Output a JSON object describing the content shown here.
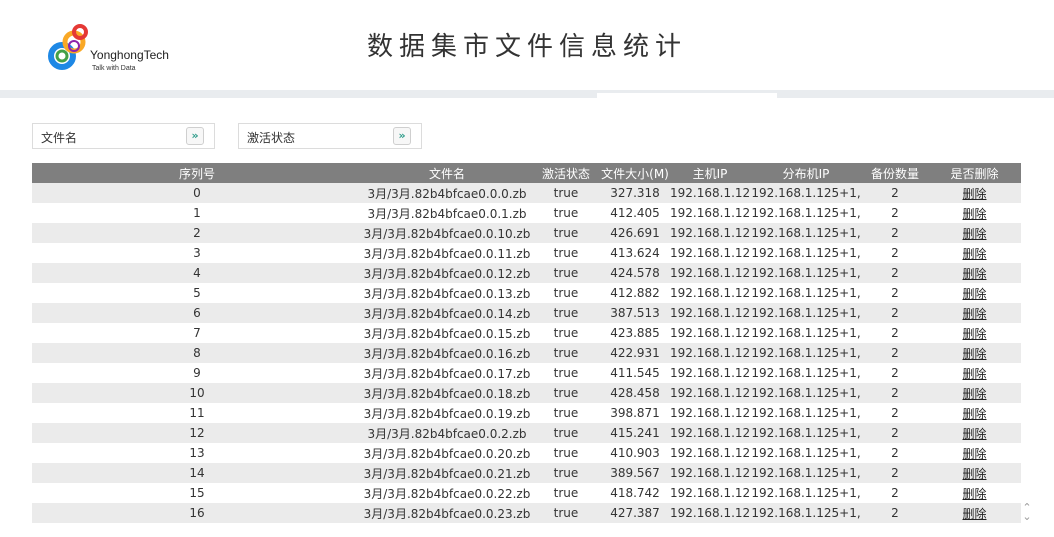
{
  "header": {
    "title": "数据集市文件信息统计",
    "logo": {
      "name": "YonghongTech",
      "tagline": "Talk with Data"
    }
  },
  "filters": {
    "file_name": {
      "label": "文件名",
      "icon": "chevron-double-down-icon"
    },
    "active_status": {
      "label": "激活状态",
      "icon": "chevron-double-down-icon"
    }
  },
  "table": {
    "headers": [
      "序列号",
      "文件名",
      "激活状态",
      "文件大小(M)",
      "主机IP",
      "分布机IP",
      "备份数量",
      "是否删除"
    ],
    "rows": [
      [
        "0",
        "3月/3月.82b4bfcae0.0.0.zb",
        "true",
        "327.318",
        "192.168.1.12",
        "192.168.1.125+1,",
        "2",
        "删除"
      ],
      [
        "1",
        "3月/3月.82b4bfcae0.0.1.zb",
        "true",
        "412.405",
        "192.168.1.12",
        "192.168.1.125+1,",
        "2",
        "删除"
      ],
      [
        "2",
        "3月/3月.82b4bfcae0.0.10.zb",
        "true",
        "426.691",
        "192.168.1.12",
        "192.168.1.125+1,",
        "2",
        "删除"
      ],
      [
        "3",
        "3月/3月.82b4bfcae0.0.11.zb",
        "true",
        "413.624",
        "192.168.1.12",
        "192.168.1.125+1,",
        "2",
        "删除"
      ],
      [
        "4",
        "3月/3月.82b4bfcae0.0.12.zb",
        "true",
        "424.578",
        "192.168.1.12",
        "192.168.1.125+1,",
        "2",
        "删除"
      ],
      [
        "5",
        "3月/3月.82b4bfcae0.0.13.zb",
        "true",
        "412.882",
        "192.168.1.12",
        "192.168.1.125+1,",
        "2",
        "删除"
      ],
      [
        "6",
        "3月/3月.82b4bfcae0.0.14.zb",
        "true",
        "387.513",
        "192.168.1.12",
        "192.168.1.125+1,",
        "2",
        "删除"
      ],
      [
        "7",
        "3月/3月.82b4bfcae0.0.15.zb",
        "true",
        "423.885",
        "192.168.1.12",
        "192.168.1.125+1,",
        "2",
        "删除"
      ],
      [
        "8",
        "3月/3月.82b4bfcae0.0.16.zb",
        "true",
        "422.931",
        "192.168.1.12",
        "192.168.1.125+1,",
        "2",
        "删除"
      ],
      [
        "9",
        "3月/3月.82b4bfcae0.0.17.zb",
        "true",
        "411.545",
        "192.168.1.12",
        "192.168.1.125+1,",
        "2",
        "删除"
      ],
      [
        "10",
        "3月/3月.82b4bfcae0.0.18.zb",
        "true",
        "428.458",
        "192.168.1.12",
        "192.168.1.125+1,",
        "2",
        "删除"
      ],
      [
        "11",
        "3月/3月.82b4bfcae0.0.19.zb",
        "true",
        "398.871",
        "192.168.1.12",
        "192.168.1.125+1,",
        "2",
        "删除"
      ],
      [
        "12",
        "3月/3月.82b4bfcae0.0.2.zb",
        "true",
        "415.241",
        "192.168.1.12",
        "192.168.1.125+1,",
        "2",
        "删除"
      ],
      [
        "13",
        "3月/3月.82b4bfcae0.0.20.zb",
        "true",
        "410.903",
        "192.168.1.12",
        "192.168.1.125+1,",
        "2",
        "删除"
      ],
      [
        "14",
        "3月/3月.82b4bfcae0.0.21.zb",
        "true",
        "389.567",
        "192.168.1.12",
        "192.168.1.125+1,",
        "2",
        "删除"
      ],
      [
        "15",
        "3月/3月.82b4bfcae0.0.22.zb",
        "true",
        "418.742",
        "192.168.1.12",
        "192.168.1.125+1,",
        "2",
        "删除"
      ],
      [
        "16",
        "3月/3月.82b4bfcae0.0.23.zb",
        "true",
        "427.387",
        "192.168.1.12",
        "192.168.1.125+1,",
        "2",
        "删除"
      ]
    ]
  },
  "colors": {
    "header_bg": "#7f7f7f",
    "row_alt_bg": "#ebebeb",
    "accent": "#2e9c8a"
  }
}
